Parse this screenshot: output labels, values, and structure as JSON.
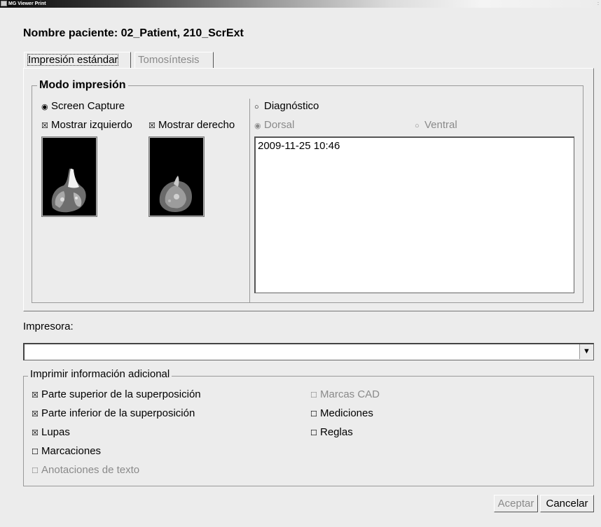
{
  "window": {
    "title": "MG Viewer Print"
  },
  "patient_title": "Nombre paciente: 02_Patient, 210_ScrExt",
  "tabs": [
    {
      "label": "Impresión estándar",
      "active": true
    },
    {
      "label": "Tomosíntesis",
      "active": false
    }
  ],
  "print_mode": {
    "legend": "Modo impresión",
    "screen_capture": {
      "label": "Screen Capture",
      "selected": true
    },
    "show_left": {
      "label": "Mostrar izquierdo",
      "checked": true
    },
    "show_right": {
      "label": "Mostrar derecho",
      "checked": true
    },
    "diagnostic": {
      "label": "Diagnóstico",
      "selected": false
    },
    "dorsal": {
      "label": "Dorsal",
      "selected": true,
      "enabled": false
    },
    "ventral": {
      "label": "Ventral",
      "selected": false,
      "enabled": false
    },
    "dates": [
      "2009-11-25 10:46"
    ]
  },
  "printer": {
    "label": "Impresora:",
    "value": ""
  },
  "additional_info": {
    "legend": "Imprimir información adicional",
    "options": [
      {
        "label": "Parte superior de la superposición",
        "checked": true,
        "enabled": true
      },
      {
        "label": "Parte inferior de la superposición",
        "checked": true,
        "enabled": true
      },
      {
        "label": "Lupas",
        "checked": true,
        "enabled": true
      },
      {
        "label": "Marcaciones",
        "checked": false,
        "enabled": true
      },
      {
        "label": "Anotaciones de texto",
        "checked": false,
        "enabled": false
      },
      {
        "label": "Marcas CAD",
        "checked": false,
        "enabled": false
      },
      {
        "label": "Mediciones",
        "checked": false,
        "enabled": true
      },
      {
        "label": "Reglas",
        "checked": false,
        "enabled": true
      }
    ]
  },
  "buttons": {
    "accept": "Aceptar",
    "cancel": "Cancelar"
  }
}
